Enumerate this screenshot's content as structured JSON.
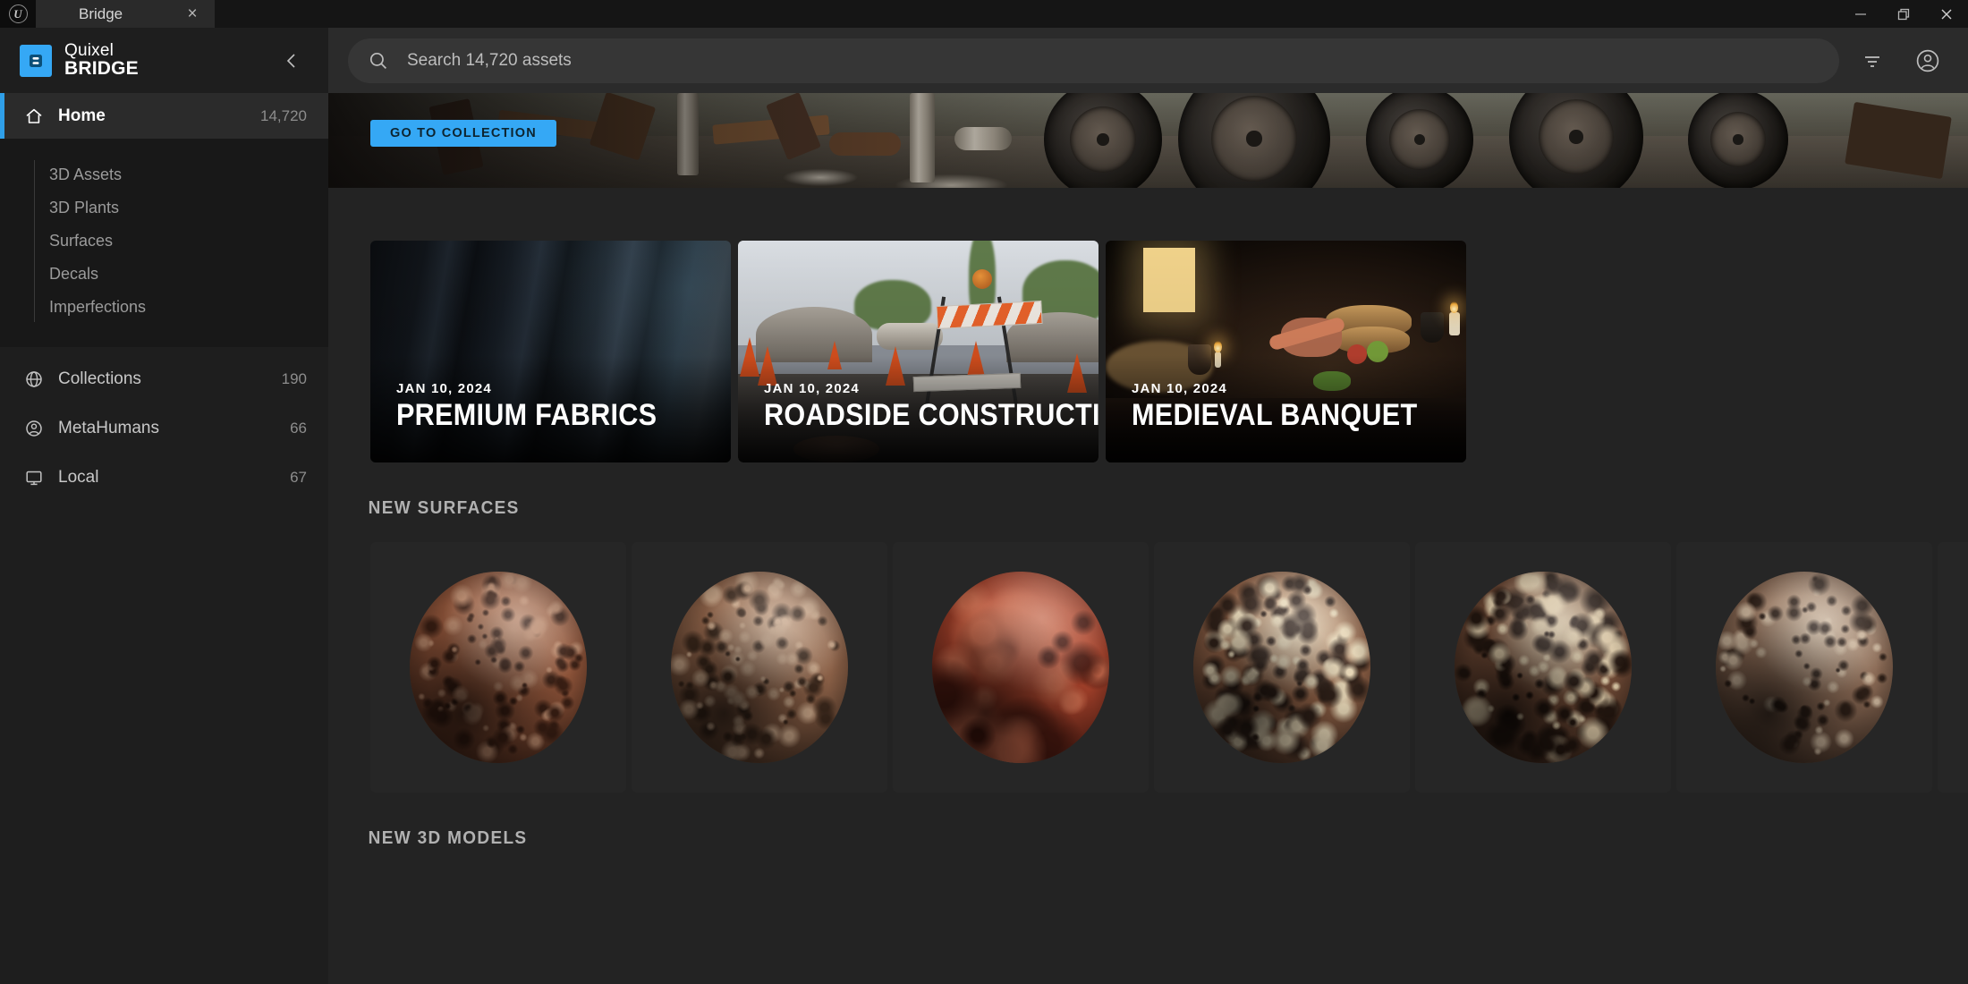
{
  "window": {
    "app_icon": "unreal-engine-icon",
    "tab_label": "Bridge",
    "tab_close": "×",
    "controls": [
      "minimize-icon",
      "restore-icon",
      "close-icon"
    ]
  },
  "brand": {
    "mark_icon": "bridge-logo-icon",
    "line1": "Quixel",
    "line2": "BRIDGE",
    "accent": "#35a8f5",
    "collapse_icon": "chevron-left-icon"
  },
  "search": {
    "icon": "search-icon",
    "placeholder": "Search 14,720 assets",
    "value": "",
    "filter_icon": "filter-icon",
    "account_icon": "user-account-icon"
  },
  "sidebar": {
    "primary": [
      {
        "label": "Home",
        "count": "14,720",
        "icon": "home-icon",
        "active": true
      }
    ],
    "sub_items": [
      {
        "label": "3D Assets"
      },
      {
        "label": "3D Plants"
      },
      {
        "label": "Surfaces"
      },
      {
        "label": "Decals"
      },
      {
        "label": "Imperfections"
      }
    ],
    "groups": [
      {
        "label": "Collections",
        "count": "190",
        "icon": "globe-icon"
      },
      {
        "label": "MetaHumans",
        "count": "66",
        "icon": "user-circle-icon"
      },
      {
        "label": "Local",
        "count": "67",
        "icon": "monitor-icon"
      }
    ]
  },
  "hero": {
    "button_label": "GO TO COLLECTION",
    "button_color": "#35a8f5",
    "art_alt": "scrapyard-banner"
  },
  "collections": [
    {
      "date": "JAN 10, 2024",
      "title": "PREMIUM FABRICS",
      "art": "fabric"
    },
    {
      "date": "JAN 10, 2024",
      "title": "ROADSIDE CONSTRUCTION",
      "art": "road"
    },
    {
      "date": "JAN 10, 2024",
      "title": "MEDIEVAL BANQUET",
      "art": "banquet"
    }
  ],
  "sections": [
    {
      "title": "NEW SURFACES",
      "tiles": [
        {
          "name": "rocky-red-ground-sphere",
          "base": "#8c5339",
          "dark": "#3a1f14",
          "light": "#b8876a",
          "grain": "coarse"
        },
        {
          "name": "cracked-brown-rock-sphere",
          "base": "#8a6047",
          "dark": "#3b281c",
          "light": "#c3a184",
          "grain": "coarse"
        },
        {
          "name": "smooth-red-clay-sphere",
          "base": "#a8432c",
          "dark": "#4a1a11",
          "light": "#c4674a",
          "grain": "smooth"
        },
        {
          "name": "pebbled-gravel-sphere",
          "base": "#96664a",
          "dark": "#31221a",
          "light": "#e6d6b6",
          "grain": "pebbles"
        },
        {
          "name": "gritty-dark-soil-sphere",
          "base": "#6f4a36",
          "dark": "#241710",
          "light": "#d6c3a2",
          "grain": "pebbles"
        },
        {
          "name": "fine-brown-sand-sphere",
          "base": "#8a6a55",
          "dark": "#2e2018",
          "light": "#c9b39a",
          "grain": "fine"
        },
        {
          "name": "partial-edge-sphere",
          "base": "#9a6a4e",
          "dark": "#3b261a",
          "light": "#c99c79",
          "grain": "fine"
        }
      ]
    },
    {
      "title": "NEW 3D MODELS",
      "tiles": []
    }
  ]
}
